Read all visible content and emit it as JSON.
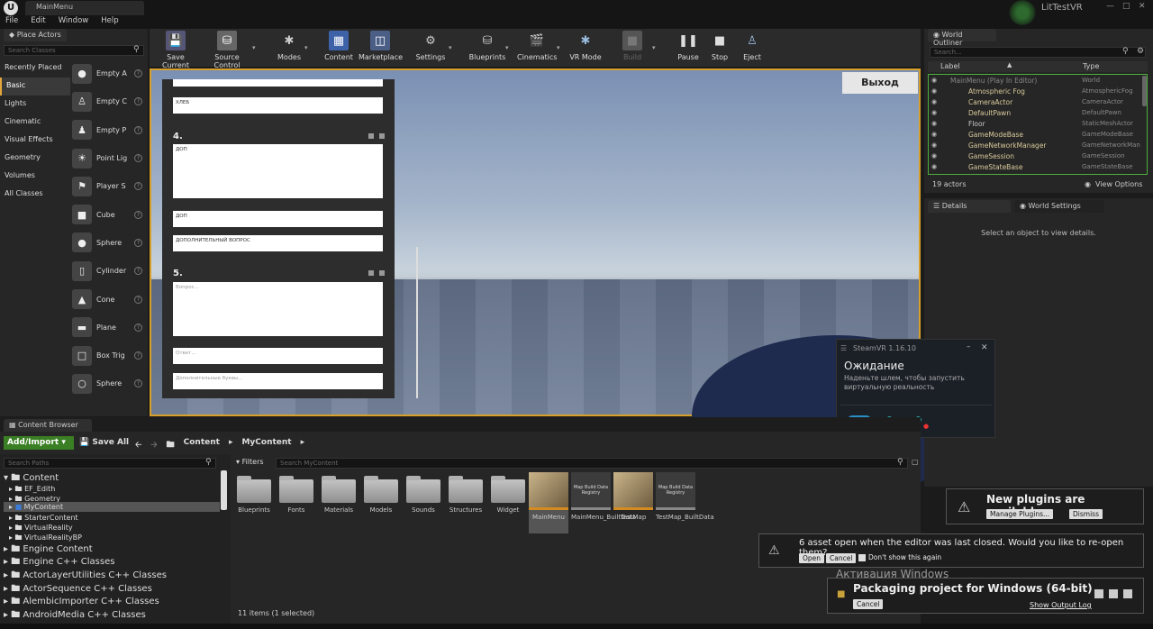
{
  "window": {
    "doc_tab": "MainMenu",
    "project_name": "LitTestVR",
    "menus": [
      "File",
      "Edit",
      "Window",
      "Help"
    ]
  },
  "place_actors": {
    "tab": "Place Actors",
    "search_placeholder": "Search Classes",
    "categories": [
      "Recently Placed",
      "Basic",
      "Lights",
      "Cinematic",
      "Visual Effects",
      "Geometry",
      "Volumes",
      "All Classes"
    ],
    "items": [
      {
        "label": "Empty A",
        "icon": "sphere"
      },
      {
        "label": "Empty C",
        "icon": "figure"
      },
      {
        "label": "Empty P",
        "icon": "pawn"
      },
      {
        "label": "Point Lig",
        "icon": "bulb"
      },
      {
        "label": "Player S",
        "icon": "flag"
      },
      {
        "label": "Cube",
        "icon": "cube"
      },
      {
        "label": "Sphere",
        "icon": "sphere"
      },
      {
        "label": "Cylinder",
        "icon": "cylinder"
      },
      {
        "label": "Cone",
        "icon": "cone"
      },
      {
        "label": "Plane",
        "icon": "plane"
      },
      {
        "label": "Box Trig",
        "icon": "box"
      },
      {
        "label": "Sphere ",
        "icon": "sphere"
      }
    ]
  },
  "toolbar": {
    "buttons": [
      {
        "label": "Save Current",
        "icon": "save-icon"
      },
      {
        "label": "Source Control",
        "icon": "source-control-icon"
      },
      {
        "label": "Modes",
        "icon": "modes-icon"
      },
      {
        "label": "Content",
        "icon": "content-icon"
      },
      {
        "label": "Marketplace",
        "icon": "marketplace-icon"
      },
      {
        "label": "Settings",
        "icon": "settings-icon"
      },
      {
        "label": "Blueprints",
        "icon": "blueprints-icon"
      },
      {
        "label": "Cinematics",
        "icon": "cinematics-icon"
      },
      {
        "label": "VR Mode",
        "icon": "vr-icon"
      },
      {
        "label": "Build",
        "icon": "build-icon"
      },
      {
        "label": "Pause",
        "icon": "pause-icon"
      },
      {
        "label": "Stop",
        "icon": "stop-icon"
      },
      {
        "label": "Eject",
        "icon": "eject-icon"
      }
    ]
  },
  "viewport": {
    "exit_button": "Выход",
    "form": {
      "field1": "ХЛЕБ",
      "q4_number": "4.",
      "q4_question": "ДОП",
      "q4_answer": "ДОП",
      "q4_extra": "ДОПОЛНИТЕЛЬНЫЙ ВОПРОС",
      "q5_number": "5.",
      "q5_question": "Вопрос...",
      "q5_answer": "Ответ...",
      "q5_extra": "Дополнительные буквы..."
    }
  },
  "world_outliner": {
    "tab": "World Outliner",
    "search_placeholder": "Search...",
    "col_label": "Label",
    "col_type": "Type",
    "rows": [
      {
        "label": "MainMenu (Play In Editor)",
        "type": "World"
      },
      {
        "label": "Atmospheric Fog",
        "type": "AtmosphericFog"
      },
      {
        "label": "CameraActor",
        "type": "CameraActor"
      },
      {
        "label": "DefaultPawn",
        "type": "DefaultPawn"
      },
      {
        "label": "Floor",
        "type": "StaticMeshActor"
      },
      {
        "label": "GameModeBase",
        "type": "GameModeBase"
      },
      {
        "label": "GameNetworkManager",
        "type": "GameNetworkMan"
      },
      {
        "label": "GameSession",
        "type": "GameSession"
      },
      {
        "label": "GameStateBase",
        "type": "GameStateBase"
      }
    ],
    "actor_count": "19 actors",
    "view_options": "View Options"
  },
  "details": {
    "tab_details": "Details",
    "tab_world_settings": "World Settings",
    "empty_message": "Select an object to view details."
  },
  "steamvr": {
    "title": "SteamVR 1.16.10",
    "status": "Ожидание",
    "message_line1": "Наденьте шлем, чтобы запустить",
    "message_line2": "виртуальную реальность"
  },
  "content_browser": {
    "tab": "Content Browser",
    "add_import": "Add/Import",
    "save_all": "Save All",
    "breadcrumb": [
      "Content",
      "MyContent"
    ],
    "paths_search_placeholder": "Search Paths",
    "filters": "Filters",
    "search_placeholder": "Search MyContent",
    "tree_small": [
      "EF_Edith",
      "Geometry",
      "MyContent",
      "StarterContent",
      "VirtualReality",
      "VirtualRealityBP"
    ],
    "tree_root": "Content",
    "tree_big": [
      "Engine Content",
      "Engine C++ Classes",
      "ActorLayerUtilities C++ Classes",
      "ActorSequence C++ Classes",
      "AlembicImporter C++ Classes",
      "AndroidMedia C++ Classes"
    ],
    "folders": [
      "Blueprints",
      "Fonts",
      "Materials",
      "Models",
      "Sounds",
      "Structures",
      "Widget"
    ],
    "assets": [
      {
        "label": "MainMenu",
        "thumb": ""
      },
      {
        "label": "MainMenu_BuiltData",
        "thumb": "Map Build Data Registry"
      },
      {
        "label": "TestMap",
        "thumb": ""
      },
      {
        "label": "TestMap_BuiltData",
        "thumb": "Map Build Data Registry"
      }
    ],
    "item_count": "11 items (1 selected)"
  },
  "notifications": {
    "plugins": {
      "text": "New plugins are available",
      "manage": "Manage Plugins...",
      "dismiss": "Dismiss"
    },
    "reopen": {
      "text": "6 asset  open when the editor was last closed. Would you like to re-open them?",
      "open": "Open",
      "cancel": "Cancel",
      "dont_show": "Don't show this again"
    },
    "activation": "Активация Windows",
    "packaging": {
      "text": "Packaging project for Windows (64-bit)",
      "cancel": "Cancel",
      "show_log": "Show Output Log"
    }
  }
}
